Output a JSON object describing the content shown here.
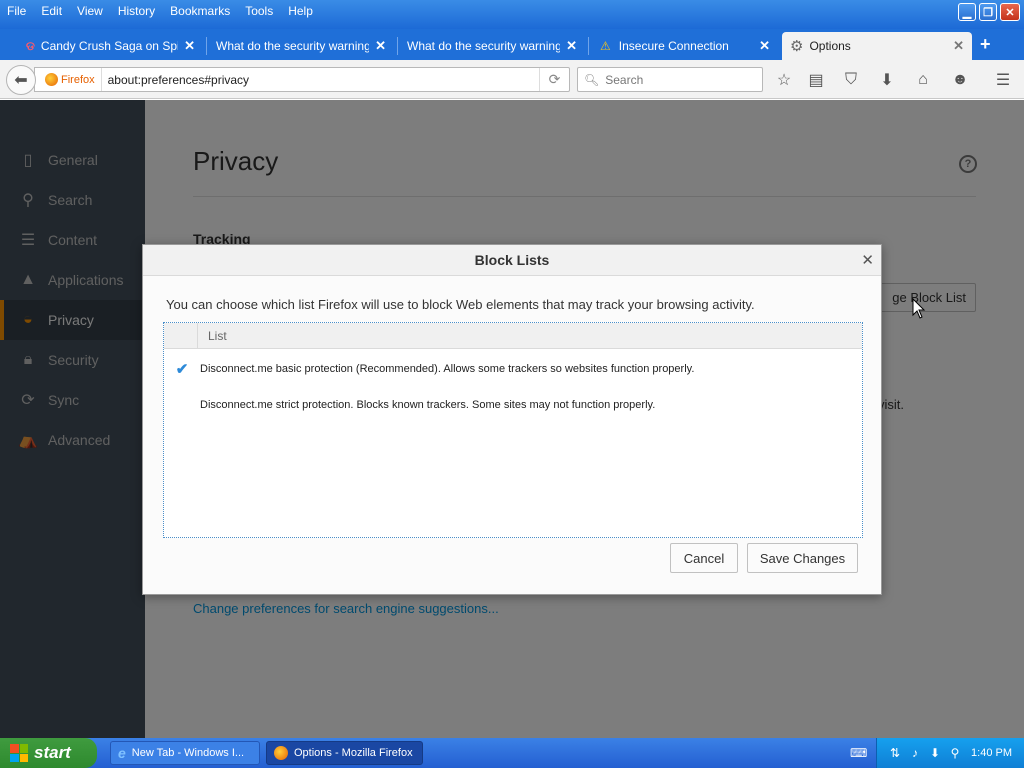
{
  "menu": [
    "File",
    "Edit",
    "View",
    "History",
    "Bookmarks",
    "Tools",
    "Help"
  ],
  "tabs": [
    {
      "title": "Candy Crush Saga on Spiri..."
    },
    {
      "title": "What do the security warning c..."
    },
    {
      "title": "What do the security warning c..."
    },
    {
      "title": "Insecure Connection"
    },
    {
      "title": "Options"
    }
  ],
  "navbar": {
    "identity_label": "Firefox",
    "url": "about:preferences#privacy",
    "search_placeholder": "Search"
  },
  "sidebar": {
    "items": [
      {
        "label": "General"
      },
      {
        "label": "Search"
      },
      {
        "label": "Content"
      },
      {
        "label": "Applications"
      },
      {
        "label": "Privacy"
      },
      {
        "label": "Security"
      },
      {
        "label": "Sync"
      },
      {
        "label": "Advanced"
      }
    ]
  },
  "page": {
    "title": "Privacy",
    "tracking_heading": "Tracking",
    "change_block_list_partial": "ge Block List",
    "visit_partial": "visit.",
    "search_suggestions_link": "Change preferences for search engine suggestions..."
  },
  "dialog": {
    "title": "Block Lists",
    "description": "You can choose which list Firefox will use to block Web elements that may track your browsing activity.",
    "list_header": "List",
    "rows": [
      {
        "text": "Disconnect.me basic protection (Recommended). Allows some trackers so websites function properly.",
        "checked": true
      },
      {
        "text": "Disconnect.me strict protection. Blocks known trackers. Some sites may not function properly.",
        "checked": false
      }
    ],
    "cancel_label": "Cancel",
    "save_label": "Save Changes"
  },
  "taskbar": {
    "start_label": "start",
    "items": [
      {
        "label": "New Tab - Windows I..."
      },
      {
        "label": "Options - Mozilla Firefox"
      }
    ],
    "clock": "1:40 PM"
  }
}
